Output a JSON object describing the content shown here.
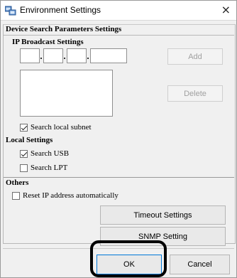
{
  "window": {
    "title": "Environment Settings",
    "close_glyph": "×",
    "icon": "settings-app-icon"
  },
  "device_search": {
    "heading": "Device Search Parameters Settings",
    "ip_broadcast": {
      "heading": "IP Broadcast Settings",
      "octets": [
        "",
        "",
        "",
        ""
      ],
      "add_label": "Add",
      "delete_label": "Delete",
      "list_items": []
    },
    "search_local_subnet": {
      "label": "Search local subnet",
      "checked": true
    }
  },
  "local_settings": {
    "heading": "Local Settings",
    "search_usb": {
      "label": "Search USB",
      "checked": true
    },
    "search_lpt": {
      "label": "Search LPT",
      "checked": false
    }
  },
  "others": {
    "heading": "Others",
    "reset_ip": {
      "label": "Reset IP address automatically",
      "checked": false
    },
    "timeout_label": "Timeout Settings",
    "snmp_label": "SNMP Setting"
  },
  "footer": {
    "ok_label": "OK",
    "cancel_label": "Cancel"
  }
}
